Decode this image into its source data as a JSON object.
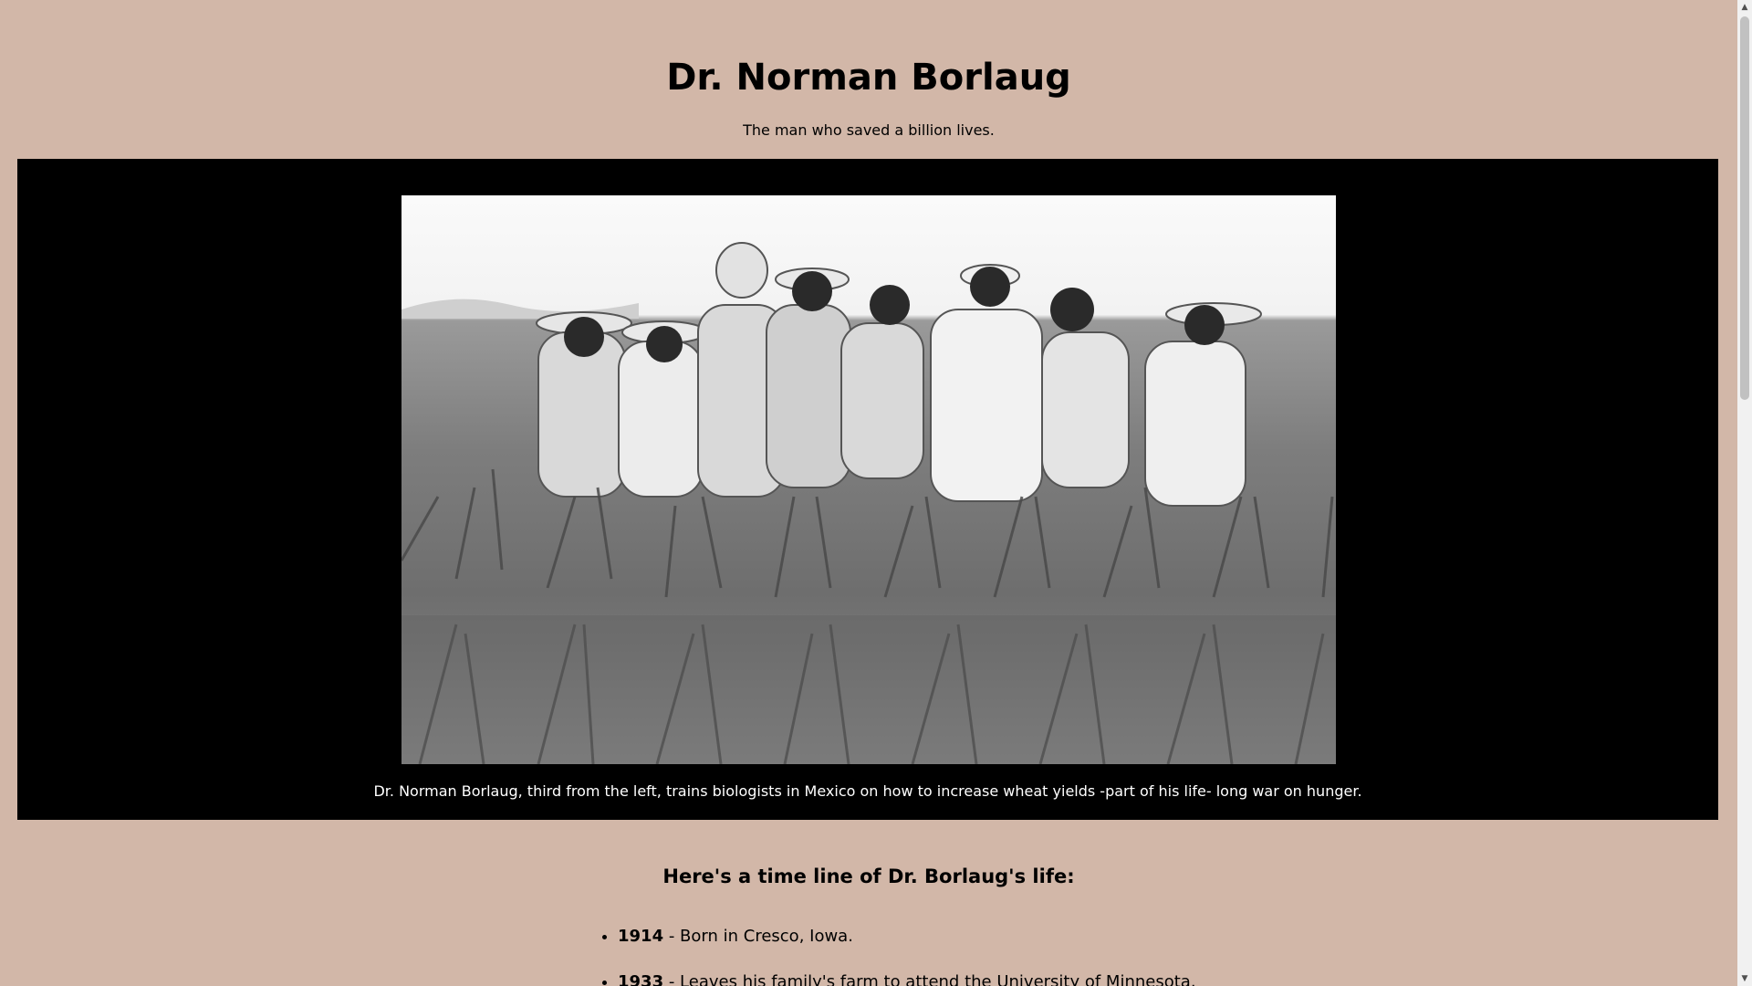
{
  "header": {
    "title": "Dr. Norman Borlaug",
    "tagline": "The man who saved a billion lives."
  },
  "image_panel": {
    "caption": "Dr. Norman Borlaug, third from the left, trains biologists in Mexico on how to increase wheat yields -part of his life- long war on hunger."
  },
  "timeline": {
    "heading": "Here's a time line of Dr. Borlaug's life:",
    "items": [
      {
        "year": "1914",
        "text": " - Born in Cresco, Iowa."
      },
      {
        "year": "1933",
        "text": " - Leaves his family's farm to attend the University of Minnesota."
      }
    ]
  },
  "colors": {
    "page_background": "#d2b7a8",
    "image_panel_background": "#000000"
  },
  "icons": {
    "scroll_up": "▲",
    "scroll_down": "▼"
  }
}
